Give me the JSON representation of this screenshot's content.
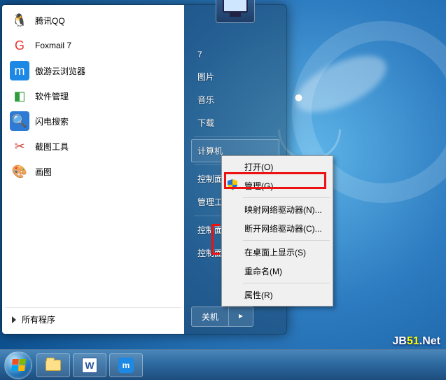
{
  "user_picture": "monitor-icon",
  "left_programs": [
    {
      "label": "腾讯QQ",
      "icon_name": "qq-icon",
      "icon_bg": "#fff",
      "icon_glyph": "🐧"
    },
    {
      "label": "Foxmail 7",
      "icon_name": "foxmail-icon",
      "icon_bg": "#fff",
      "icon_glyph": "G",
      "icon_color": "#e5322d"
    },
    {
      "label": "傲游云浏览器",
      "icon_name": "maxthon-icon",
      "icon_bg": "#1e88e5",
      "icon_glyph": "m",
      "icon_color": "#fff"
    },
    {
      "label": "软件管理",
      "icon_name": "softmgr-icon",
      "icon_bg": "#fff",
      "icon_glyph": "◧",
      "icon_color": "#2e9e3a"
    },
    {
      "label": "闪电搜索",
      "icon_name": "flashsearch-icon",
      "icon_bg": "#2e7bd6",
      "icon_glyph": "🔍",
      "icon_color": "#fff"
    },
    {
      "label": "截图工具",
      "icon_name": "snip-icon",
      "icon_bg": "#fff",
      "icon_glyph": "✂",
      "icon_color": "#d0463b"
    },
    {
      "label": "画图",
      "icon_name": "paint-icon",
      "icon_bg": "#fff",
      "icon_glyph": "🎨"
    }
  ],
  "all_programs_label": "所有程序",
  "right_items": {
    "user": "7",
    "pictures": "图片",
    "music": "音乐",
    "downloads": "下载",
    "computer": "计算机",
    "control_panel": "控制面板",
    "admin_tools": "管理工具",
    "control_panel_desktop": "控制面板\\桌面",
    "control_panel_show": "控制面板\\示(S)"
  },
  "shutdown": {
    "label": "关机"
  },
  "context_menu": {
    "open": "打开(O)",
    "manage": "管理(G)",
    "map_drive": "映射网络驱动器(N)...",
    "disconnect_drive": "断开网络驱动器(C)...",
    "show_on_desktop": "在桌面上显示(S)",
    "rename": "重命名(M)",
    "properties": "属性(R)"
  },
  "watermark": {
    "a": "JB",
    "b": "51",
    "c": ".Net"
  }
}
